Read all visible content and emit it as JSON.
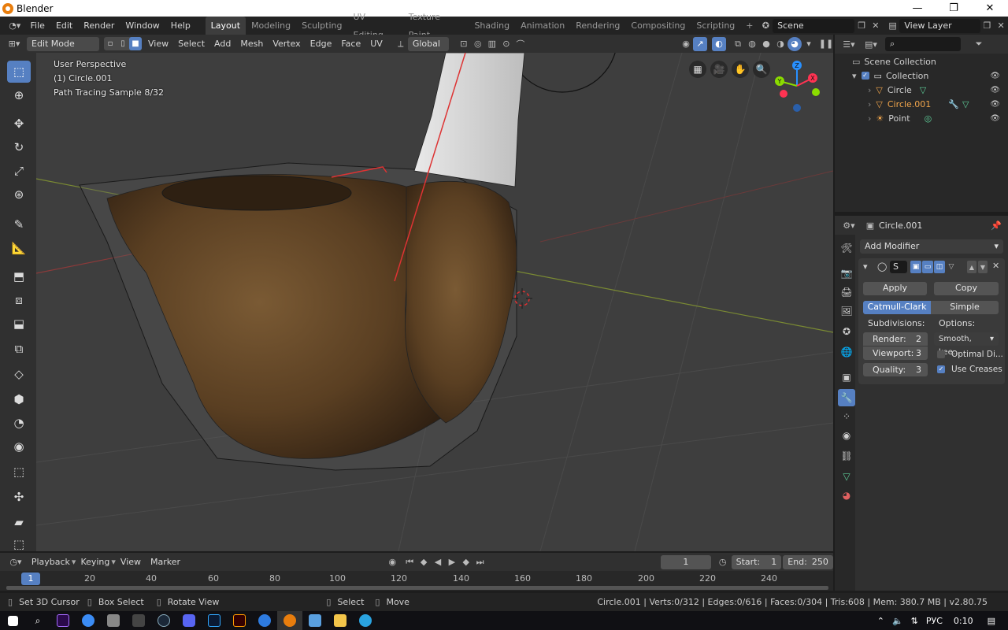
{
  "window": {
    "title": "Blender",
    "controls": [
      "—",
      "❐",
      "✕"
    ]
  },
  "topbar": {
    "menus": [
      "File",
      "Edit",
      "Render",
      "Window",
      "Help"
    ],
    "workspaces": [
      "Layout",
      "Modeling",
      "Sculpting",
      "UV Editing",
      "Texture Paint",
      "Shading",
      "Animation",
      "Rendering",
      "Compositing",
      "Scripting"
    ],
    "active_workspace": "Layout",
    "add_workspace": "+",
    "scene": "Scene",
    "view_layer": "View Layer"
  },
  "viewport_header": {
    "mode": "Edit Mode",
    "menus": [
      "View",
      "Select",
      "Add",
      "Mesh",
      "Vertex",
      "Edge",
      "Face",
      "UV"
    ],
    "orientation": "Global"
  },
  "viewport": {
    "perspective": "User Perspective",
    "object": "(1) Circle.001",
    "render_status": "Path Tracing Sample 8/32",
    "gizmo": {
      "x": "X",
      "y": "Y",
      "z": "Z"
    }
  },
  "outliner": {
    "search_placeholder": "",
    "root": "Scene Collection",
    "collection": "Collection",
    "items": [
      {
        "name": "Circle",
        "color": "#d8d8d8"
      },
      {
        "name": "Circle.001",
        "color": "#f1a54b"
      },
      {
        "name": "Point",
        "color": "#d8d8d8"
      }
    ]
  },
  "properties": {
    "object_name": "Circle.001",
    "add_modifier": "Add Modifier",
    "modifier_name": "S",
    "apply": "Apply",
    "copy": "Copy",
    "catmull": "Catmull-Clark",
    "simple": "Simple",
    "subdivisions_label": "Subdivisions:",
    "options_label": "Options:",
    "render_label": "Render:",
    "render_value": "2",
    "viewport_label": "Viewport:",
    "viewport_value": "3",
    "quality_label": "Quality:",
    "quality_value": "3",
    "smooth": "Smooth, kee...",
    "optimal": "Optimal Di...",
    "optimal_checked": false,
    "use_creases": "Use Creases",
    "use_creases_checked": true
  },
  "timeline": {
    "menus": [
      "Playback",
      "Keying",
      "View",
      "Marker"
    ],
    "current_frame": "1",
    "start_label": "Start:",
    "start": "1",
    "end_label": "End:",
    "end": "250",
    "ticks": [
      "1",
      "20",
      "40",
      "60",
      "80",
      "100",
      "120",
      "140",
      "160",
      "180",
      "200",
      "220",
      "240"
    ]
  },
  "statusbar": {
    "left1": "Set 3D Cursor",
    "left2": "Box Select",
    "left3": "Rotate View",
    "mid1": "Select",
    "mid2": "Move",
    "stats": "Circle.001 | Verts:0/312 | Edges:0/616 | Faces:0/304 | Tris:608 | Mem: 380.7 MB | v2.80.75"
  },
  "taskbar": {
    "lang": "РУС",
    "time": "0:10"
  },
  "colors": {
    "accent": "#5680c2",
    "active_object": "#f1a54b",
    "axis_x": "#ff3352",
    "axis_y": "#8bdc00",
    "axis_z": "#2890ff"
  }
}
